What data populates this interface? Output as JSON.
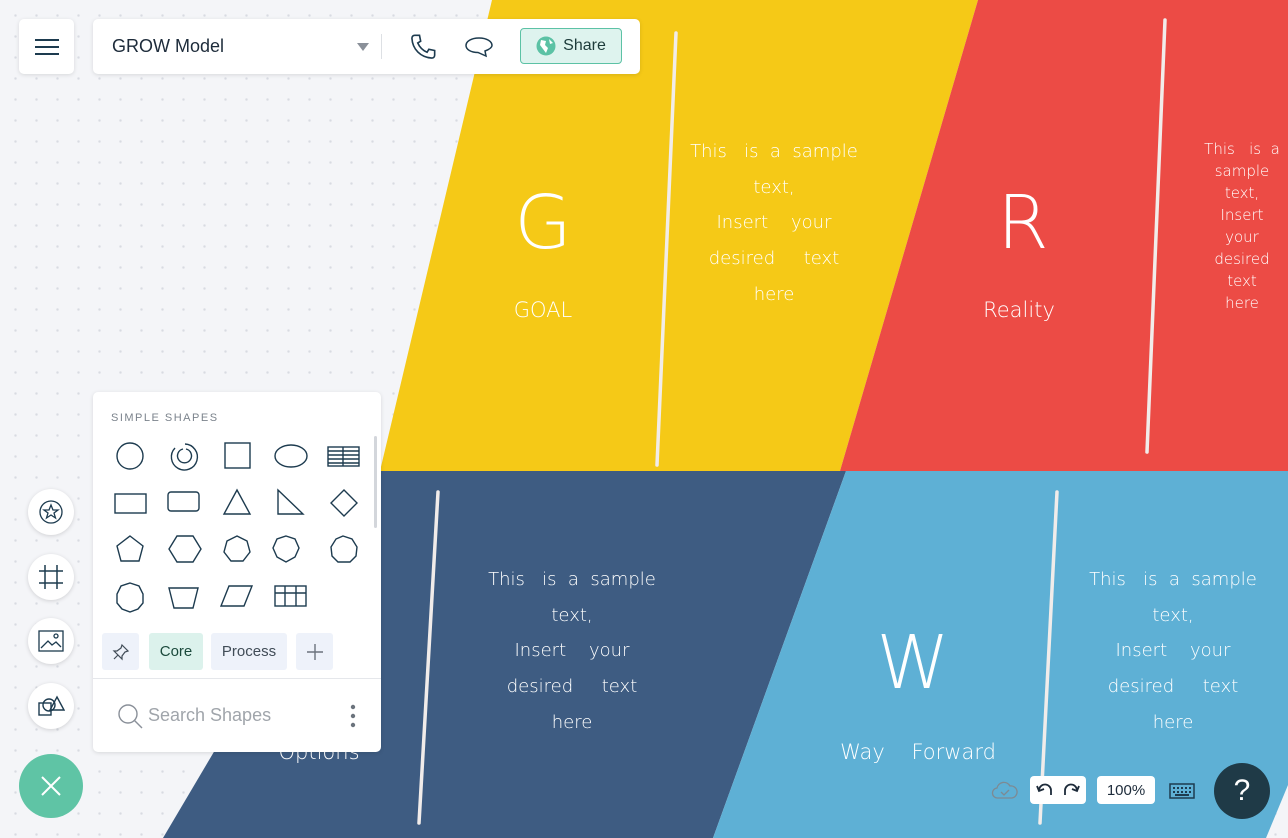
{
  "header": {
    "title": "GROW Model",
    "share_label": "Share"
  },
  "quadrants": [
    {
      "letter": "G",
      "label": "GOAL",
      "color": "#f5c917",
      "text": "This   is  a  sample\ntext,\nInsert    your\ndesired     text\nhere"
    },
    {
      "letter": "R",
      "label": "Reality",
      "color": "#ec4b45",
      "text": "This   is  a  sample\ntext,\nInsert    your\ndesired     text\nhere"
    },
    {
      "letter": "",
      "label": "Options",
      "color": "#3e5c82",
      "text": "This   is  a  sample\ntext,\nInsert    your\ndesired     text\nhere"
    },
    {
      "letter": "W",
      "label": "Way    Forward",
      "color": "#5eb0d5",
      "text": "This   is  a  sample\ntext,\nInsert    your\ndesired     text\nhere"
    }
  ],
  "shapes_panel": {
    "title": "SIMPLE SHAPES",
    "tabs": [
      "Core",
      "Process"
    ],
    "search_placeholder": "Search Shapes"
  },
  "bottom": {
    "zoom": "100%",
    "help": "?"
  },
  "colors": {
    "accent": "#5fc4a5",
    "navy": "#1f3a47"
  }
}
